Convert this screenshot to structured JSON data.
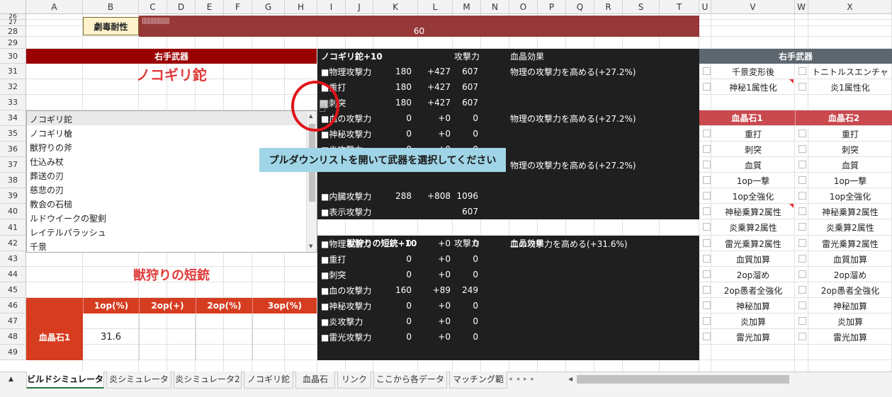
{
  "columns": [
    "A",
    "B",
    "C",
    "D",
    "E",
    "F",
    "G",
    "H",
    "I",
    "J",
    "K",
    "L",
    "M",
    "N",
    "O",
    "P",
    "Q",
    "R",
    "S",
    "T",
    "U",
    "V",
    "W",
    "X"
  ],
  "rows": [
    "26",
    "27",
    "28",
    "29",
    "30",
    "31",
    "32",
    "33",
    "34",
    "35",
    "36",
    "37",
    "38",
    "39",
    "40",
    "41",
    "42",
    "43",
    "44",
    "45",
    "46",
    "47",
    "48",
    "49"
  ],
  "top": {
    "label": "劇毒耐性",
    "bar_ticks": "|||||||||||||||||||",
    "value": "60"
  },
  "left": {
    "header": "右手武器",
    "weapon1": "ノコギリ鉈",
    "weapon2": "獣狩りの短銃",
    "dropdown": [
      "ノコギリ鉈",
      "ノコギリ槍",
      "獣狩りの斧",
      "仕込み杖",
      "葬送の刃",
      "慈悲の刃",
      "教会の石槌",
      "ルドウイークの聖剣",
      "レイテルパラッシュ",
      "千景"
    ],
    "table_headers": [
      "1op(%)",
      "2op(+)",
      "2op(%)",
      "3op(%)"
    ],
    "row_label": "血晶石1",
    "row_value": "31.6"
  },
  "panel1": {
    "title": "ノコギリ鉈+10",
    "atk_label": "攻撃力",
    "effect_label": "血晶効果",
    "rows": [
      {
        "name": "■物理攻撃力",
        "base": "180",
        "plus": "+427",
        "total": "607",
        "effect": "物理の攻撃力を高める(+27.2%)"
      },
      {
        "name": "■重打",
        "base": "180",
        "plus": "+427",
        "total": "607",
        "effect": ""
      },
      {
        "name": "■刺突",
        "base": "180",
        "plus": "+427",
        "total": "607",
        "effect": ""
      },
      {
        "name": "■血の攻撃力",
        "base": "0",
        "plus": "+0",
        "total": "0",
        "effect": "物理の攻撃力を高める(+27.2%)"
      },
      {
        "name": "■神秘攻撃力",
        "base": "0",
        "plus": "+0",
        "total": "0",
        "effect": ""
      },
      {
        "name": "■炎攻撃力",
        "base": "0",
        "plus": "+0",
        "total": "0",
        "effect": ""
      },
      {
        "name": "",
        "base": "",
        "plus": "",
        "total": "",
        "effect": "物理の攻撃力を高める(+27.2%)"
      },
      {
        "name": "",
        "base": "",
        "plus": "",
        "total": "",
        "effect": ""
      },
      {
        "name": "■内臓攻撃力",
        "base": "288",
        "plus": "+808",
        "total": "1096",
        "effect": ""
      },
      {
        "name": "■表示攻撃力",
        "base": "",
        "plus": "",
        "total": "607",
        "effect": ""
      }
    ]
  },
  "panel2": {
    "title": "獣狩りの短銃+10",
    "atk_label": "攻撃力",
    "effect_label": "血晶効果",
    "rows": [
      {
        "name": "■物理攻撃力",
        "base": "0",
        "plus": "+0",
        "total": "0",
        "effect": "血の攻撃力を高める(+31.6%)"
      },
      {
        "name": "■重打",
        "base": "0",
        "plus": "+0",
        "total": "0",
        "effect": ""
      },
      {
        "name": "■刺突",
        "base": "0",
        "plus": "+0",
        "total": "0",
        "effect": ""
      },
      {
        "name": "■血の攻撃力",
        "base": "160",
        "plus": "+89",
        "total": "249",
        "effect": ""
      },
      {
        "name": "■神秘攻撃力",
        "base": "0",
        "plus": "+0",
        "total": "0",
        "effect": ""
      },
      {
        "name": "■炎攻撃力",
        "base": "0",
        "plus": "+0",
        "total": "0",
        "effect": ""
      },
      {
        "name": "■雷光攻撃力",
        "base": "0",
        "plus": "+0",
        "total": "0",
        "effect": ""
      }
    ]
  },
  "tooltip": "プルダウンリストを開いて武器を選択してください",
  "right": {
    "header": "右手武器",
    "weapon_opts": [
      [
        "千景変形後",
        "トニトルスエンチャ"
      ],
      [
        "神秘1属性化",
        "炎1属性化"
      ]
    ],
    "stone1": "血晶石1",
    "stone2": "血晶石2",
    "stones": [
      "重打",
      "刺突",
      "血質",
      "1op一撃",
      "1op全強化",
      "神秘乗算2属性",
      "炎乗算2属性",
      "雷光乗算2属性",
      "血質加算",
      "2op溜め",
      "2op愚者全強化",
      "神秘加算",
      "炎加算",
      "雷光加算"
    ]
  },
  "tabs": [
    "ビルドシミュレータ",
    "炎シミュレータ",
    "炎シミュレータ2",
    "ノコギリ鉈",
    "血晶石",
    "リンク",
    "ここから各データ",
    "マッチング範"
  ],
  "colors": {
    "dark_red": "#9b0000",
    "brown_red": "#973838",
    "orange_red": "#d63c1f",
    "tooltip_bg": "#9fd5e6",
    "weapon_text": "#e03a3a",
    "dark_panel": "#1f1f1f",
    "slate": "#5c6770",
    "rose": "#c9494f",
    "highlight_circle": "#e0141a"
  }
}
